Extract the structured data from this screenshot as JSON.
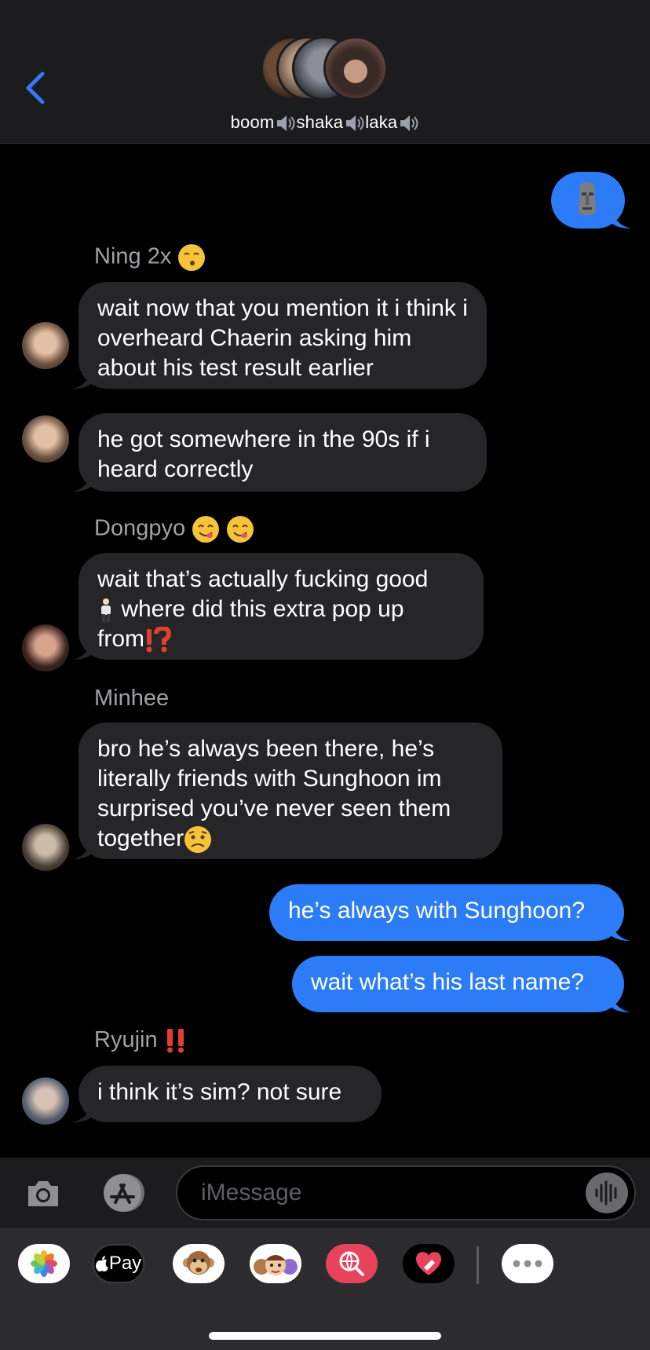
{
  "header": {
    "back_icon": "chevron-left-icon",
    "title_parts": [
      "boom",
      "shaka",
      "laka"
    ],
    "separator_icon": "speaker-icon",
    "accent_color": "#3478f6"
  },
  "messages": [
    {
      "id": "m1",
      "direction": "sent",
      "emoji_only": "moai"
    },
    {
      "id": "m2",
      "direction": "received",
      "sender": "Ning 2x",
      "sender_emoji": "kissing-face",
      "text": "wait now that you mention it i think i overheard Chaerin asking him about his test result earlier"
    },
    {
      "id": "m3",
      "direction": "received",
      "text": "he got somewhere in the 90s if i heard correctly"
    },
    {
      "id": "m4",
      "direction": "received",
      "sender": "Dongpyo",
      "sender_emoji": "yum-face x2",
      "text": "wait that’s actually fucking good",
      "text2": " where did this extra pop up",
      "text3": "from"
    },
    {
      "id": "m5",
      "direction": "received",
      "sender": "Minhee",
      "text": "bro he’s always been there, he’s literally friends with Sunghoon im surprised you’ve never seen them together"
    },
    {
      "id": "m6",
      "direction": "sent",
      "text": "he’s always with Sunghoon?"
    },
    {
      "id": "m7",
      "direction": "sent",
      "text": "wait what’s his last name?"
    },
    {
      "id": "m8",
      "direction": "received",
      "sender": "Ryujin",
      "sender_emoji": "double-exclamation",
      "text": "i think it’s sim? not sure"
    }
  ],
  "composer": {
    "placeholder": "iMessage",
    "camera_icon": "camera-icon",
    "apps_icon": "app-store-icon",
    "audio_icon": "waveform-icon"
  },
  "app_drawer": {
    "items": [
      "Photos",
      "Pay",
      "Animoji",
      "Memoji",
      "Search images",
      "Digital Touch",
      "More"
    ],
    "pay_label": "Pay"
  },
  "colors": {
    "sent_bubble": "#2b7cf6",
    "received_bubble": "#262628",
    "background": "#000000"
  }
}
